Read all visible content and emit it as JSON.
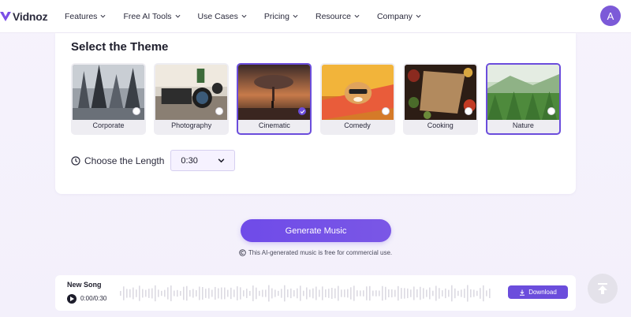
{
  "nav": {
    "logo_text": "Vidnoz",
    "items": [
      {
        "label": "Features"
      },
      {
        "label": "Free AI Tools"
      },
      {
        "label": "Use Cases"
      },
      {
        "label": "Pricing"
      },
      {
        "label": "Resource"
      },
      {
        "label": "Company"
      }
    ],
    "avatar_initial": "A"
  },
  "theme_section": {
    "title": "Select the Theme",
    "themes": [
      {
        "label": "Corporate",
        "selected": false
      },
      {
        "label": "Photography",
        "selected": false
      },
      {
        "label": "Cinematic",
        "selected": true
      },
      {
        "label": "Comedy",
        "selected": false
      },
      {
        "label": "Cooking",
        "selected": false
      },
      {
        "label": "Nature",
        "selected": true
      }
    ]
  },
  "length": {
    "label": "Choose the Length",
    "value": "0:30"
  },
  "generate": {
    "button_label": "Generate Music",
    "note": "This AI-generated music is free for commercial use."
  },
  "player": {
    "title": "New Song",
    "time": "0:00/0:30",
    "download_label": "Download"
  },
  "colors": {
    "accent": "#6b4ddc",
    "avatar": "#7c5ad8"
  }
}
